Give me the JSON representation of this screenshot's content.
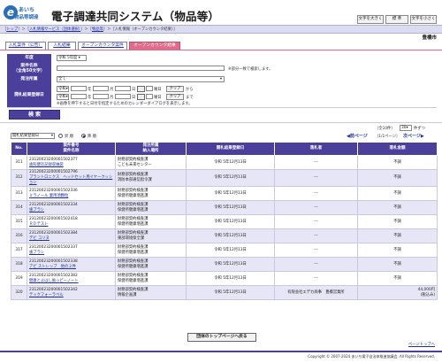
{
  "header": {
    "logo_mark": "e",
    "logo_line1": "あいち",
    "logo_line2": "物品等調達",
    "title": "電子調達共同システム（物品等）",
    "font_buttons": [
      "文字を大きく",
      "標 準",
      "文字を小さく"
    ]
  },
  "breadcrumb": {
    "top": "トップ",
    "service": "入札情報サービス（団体選択）",
    "goods": "物品等",
    "current": "入札情報（オープンカウンタ結果）"
  },
  "municipality": "豊橋市",
  "tabs": [
    "入札案件（公告）",
    "入札結果",
    "オープンカウンタ案件",
    "オープンカウンタ結果"
  ],
  "search": {
    "year_label": "年度",
    "year_value": "令和 5年度",
    "name_label": "案件名称\n（全角50文字）",
    "name_value": "",
    "name_note": "※部分一致で検索します。",
    "place_label": "発注所属",
    "place_value": "全て",
    "date_label": "開札結果登録日",
    "era": "令和",
    "year_unit": "年",
    "month_unit": "月",
    "day_unit": "日",
    "weekday_suffix": "曜日",
    "clear_label": "クリア",
    "from_label": "から",
    "to_label": "まで",
    "date_note": "※画像を押下すると日付を指定するためのカレンダーダイアログを表示します。",
    "search_button": "検 索"
  },
  "sort": {
    "field": "開札結果登録日",
    "asc": "昇 順",
    "desc": "降 順",
    "desc_selected": true
  },
  "paging": {
    "count_text": "（全10件）",
    "per_page": "30",
    "per_page_suffix": "件ずつ",
    "prev": "前ページ",
    "next": "次ページ",
    "page_info": "（1/1ページ）"
  },
  "table": {
    "headers": [
      "No.",
      "案件番号\n案件名称",
      "発注所属\n納入場所",
      "開札結果登録日",
      "落札者",
      "落札金額"
    ],
    "rows": [
      {
        "no": "311",
        "num": "23120023200001502377",
        "name": "歯科健診記録収納袋",
        "dept": "財務部契約検査課",
        "place": "こども未来センター",
        "date": "令和 5年12月13日",
        "winner": "---",
        "amount": "不調"
      },
      {
        "no": "312",
        "num": "23120023200001502796",
        "name": "プラントロニクス　ヘッドセット用イヤークッション",
        "dept": "財務部契約検査課",
        "place": "消防本部通信指令課",
        "date": "令和 5年12月13日",
        "winner": "---",
        "amount": "不調"
      },
      {
        "no": "313",
        "num": "23120023200001502336",
        "name": "ミラノール 業用頂顆粒",
        "dept": "財務部契約検査課",
        "place": "保健所健康増進課",
        "date": "令和 5年12月13日",
        "winner": "---",
        "amount": "不調"
      },
      {
        "no": "314",
        "num": "23120023200001502334",
        "name": "歯ブラシ",
        "dept": "財務部契約検査課",
        "place": "保健所健康増進課",
        "date": "令和 5年12月13日",
        "winner": "---",
        "amount": "不調"
      },
      {
        "no": "315",
        "num": "23120023200001502418",
        "name": "ＲＤテスト",
        "dept": "財務部契約検査課",
        "place": "保健所健康増進課",
        "date": "令和 5年12月13日",
        "winner": "---",
        "amount": "不調"
      },
      {
        "no": "316",
        "num": "23120023200001502384",
        "name": "デビ コリヌ",
        "dept": "財務部契約検査課",
        "place": "東部環境保全課",
        "date": "令和 5年12月13日",
        "winner": "---",
        "amount": "不調"
      },
      {
        "no": "317",
        "num": "23120023200001502337",
        "name": "歯ブラシ",
        "dept": "財務部契約検査課",
        "place": "保健所健康増進課",
        "date": "令和 5年12月13日",
        "winner": "---",
        "amount": "不調"
      },
      {
        "no": "318",
        "num": "23120023200001502338",
        "name": "アピ ストレップ　他の２件",
        "dept": "財務部契約検査課",
        "place": "保健所健康増進課",
        "date": "令和 5年12月13日",
        "winner": "---",
        "amount": "不調"
      },
      {
        "no": "319",
        "num": "23120023200001502382",
        "name": "健康とよはし歯っピーノート",
        "dept": "財務部契約検査課",
        "place": "保健所健康増進課",
        "date": "令和 5年12月13日",
        "winner": "---",
        "amount": "不調"
      },
      {
        "no": "320",
        "num": "23120023200001502342",
        "name": "テックフォーラベル",
        "dept": "財務部契約検査課",
        "place": "情報企画課",
        "date": "令和 5年12月13日",
        "winner": "有限会社エデカ商事　豊橋営業所",
        "amount": "44,000円",
        "amount_note": "(税込み)"
      }
    ]
  },
  "bottom_button": "団体のトップページへ戻る",
  "page_top": "ページトップへ",
  "copyright": "Copyright © 2007-2024 あいち電子自治体推進協議会, All Rights Reserved.",
  "colors": {
    "accent": "#4a3f9a",
    "active_tab": "#e06b8a",
    "row_alt": "#e6e6f6"
  }
}
